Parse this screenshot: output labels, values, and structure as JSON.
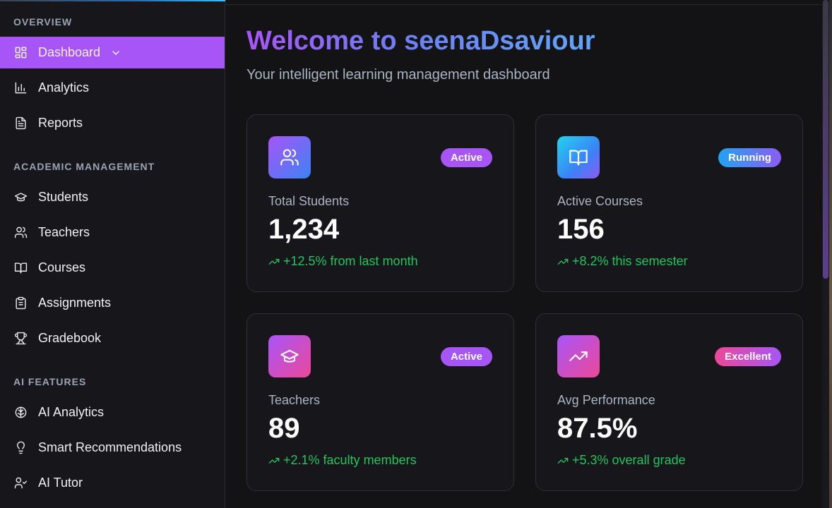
{
  "sidebar": {
    "sections": [
      {
        "title": "OVERVIEW",
        "items": [
          {
            "label": "Dashboard",
            "icon": "dashboard-grid-icon",
            "active": true,
            "expandable": true
          },
          {
            "label": "Analytics",
            "icon": "bar-chart-icon"
          },
          {
            "label": "Reports",
            "icon": "document-icon"
          }
        ]
      },
      {
        "title": "ACADEMIC MANAGEMENT",
        "items": [
          {
            "label": "Students",
            "icon": "graduation-cap-icon"
          },
          {
            "label": "Teachers",
            "icon": "users-icon"
          },
          {
            "label": "Courses",
            "icon": "book-open-icon"
          },
          {
            "label": "Assignments",
            "icon": "clipboard-list-icon"
          },
          {
            "label": "Gradebook",
            "icon": "trophy-icon"
          }
        ]
      },
      {
        "title": "AI FEATURES",
        "items": [
          {
            "label": "AI Analytics",
            "icon": "brain-icon"
          },
          {
            "label": "Smart Recommendations",
            "icon": "lightbulb-icon"
          },
          {
            "label": "AI Tutor",
            "icon": "user-check-icon"
          }
        ]
      }
    ]
  },
  "header": {
    "title": "Welcome to seenaDsaviour",
    "subtitle": "Your intelligent learning management dashboard"
  },
  "cards": [
    {
      "label": "Total Students",
      "value": "1,234",
      "change": "+12.5% from last month",
      "badge": "Active",
      "icon": "users-icon"
    },
    {
      "label": "Active Courses",
      "value": "156",
      "change": "+8.2% this semester",
      "badge": "Running",
      "icon": "book-open-icon"
    },
    {
      "label": "Teachers",
      "value": "89",
      "change": "+2.1% faculty members",
      "badge": "Active",
      "icon": "graduation-cap-icon"
    },
    {
      "label": "Avg Performance",
      "value": "87.5%",
      "change": "+5.3% overall grade",
      "badge": "Excellent",
      "icon": "trending-up-icon"
    }
  ],
  "colors": {
    "accent": "#a855f7",
    "positive": "#22c55e",
    "background": "#131316",
    "sidebar": "#17171b"
  }
}
